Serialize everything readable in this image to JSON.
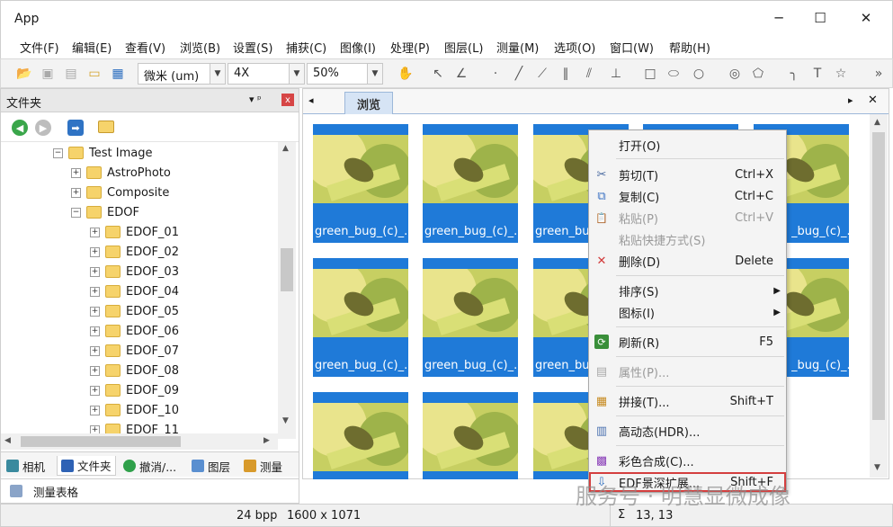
{
  "window": {
    "title": "App",
    "min_glyph": "─",
    "max_glyph": "☐",
    "close_glyph": "✕"
  },
  "menu": [
    "文件(F)",
    "编辑(E)",
    "查看(V)",
    "浏览(B)",
    "设置(S)",
    "捕获(C)",
    "图像(I)",
    "处理(P)",
    "图层(L)",
    "测量(M)",
    "选项(O)",
    "窗口(W)",
    "帮助(H)"
  ],
  "toolbar": {
    "unit": "微米 (um)",
    "magnification": "4X",
    "zoom": "50%",
    "overflow": "»"
  },
  "left_panel": {
    "title": "文件夹",
    "pin": "▾ ᵖ",
    "close": "x",
    "tree": [
      {
        "label": "Test Image",
        "expander": "−"
      },
      {
        "label": "AstroPhoto",
        "expander": "+"
      },
      {
        "label": "Composite",
        "expander": "+"
      },
      {
        "label": "EDOF",
        "expander": "−"
      },
      {
        "label": "EDOF_01",
        "expander": "+"
      },
      {
        "label": "EDOF_02",
        "expander": "+"
      },
      {
        "label": "EDOF_03",
        "expander": "+"
      },
      {
        "label": "EDOF_04",
        "expander": "+"
      },
      {
        "label": "EDOF_05",
        "expander": "+"
      },
      {
        "label": "EDOF_06",
        "expander": "+"
      },
      {
        "label": "EDOF_07",
        "expander": "+"
      },
      {
        "label": "EDOF_08",
        "expander": "+"
      },
      {
        "label": "EDOF_09",
        "expander": "+"
      },
      {
        "label": "EDOF_10",
        "expander": "+"
      },
      {
        "label": "EDOF_11",
        "expander": "+"
      }
    ],
    "tabs": [
      "相机",
      "文件夹",
      "撤消/...",
      "图层",
      "测量"
    ],
    "measure_table": "测量表格"
  },
  "browser": {
    "tab_label": "浏览",
    "nav_left": "◂",
    "nav_right": "▸",
    "close": "✕",
    "thumb_label": "green_bug_(c)_...",
    "thumb_label_short": "green_bu",
    "thumb_label_tail": "_bug_(c)_..."
  },
  "context_menu": {
    "items": [
      {
        "label": "打开(O)",
        "shortcut": "",
        "icon": "",
        "disabled": false
      },
      {
        "label": "剪切(T)",
        "shortcut": "Ctrl+X",
        "icon": "✂",
        "disabled": false
      },
      {
        "label": "复制(C)",
        "shortcut": "Ctrl+C",
        "icon": "⧉",
        "disabled": false
      },
      {
        "label": "粘贴(P)",
        "shortcut": "Ctrl+V",
        "icon": "📋",
        "disabled": true
      },
      {
        "label": "粘贴快捷方式(S)",
        "shortcut": "",
        "icon": "",
        "disabled": true
      },
      {
        "label": "删除(D)",
        "shortcut": "Delete",
        "icon": "✕",
        "disabled": false
      },
      {
        "label": "排序(S)",
        "shortcut": "▶",
        "icon": "",
        "disabled": false
      },
      {
        "label": "图标(I)",
        "shortcut": "▶",
        "icon": "",
        "disabled": false
      },
      {
        "label": "刷新(R)",
        "shortcut": "F5",
        "icon": "⟳",
        "disabled": false
      },
      {
        "label": "属性(P)...",
        "shortcut": "",
        "icon": "▤",
        "disabled": true
      },
      {
        "label": "拼接(T)...",
        "shortcut": "Shift+T",
        "icon": "▦",
        "disabled": false
      },
      {
        "label": "高动态(HDR)...",
        "shortcut": "",
        "icon": "▥",
        "disabled": false
      },
      {
        "label": "彩色合成(C)...",
        "shortcut": "",
        "icon": "▩",
        "disabled": false
      },
      {
        "label": "EDF景深扩展...",
        "shortcut": "Shift+F",
        "icon": "⇩",
        "disabled": false
      }
    ]
  },
  "status": {
    "bpp": "24 bpp",
    "dims": "1600 x 1071",
    "sigma": "Σ",
    "coords": "13, 13"
  },
  "watermark": "服务号 · 明慧显微成像",
  "colors": {
    "thumb_bg": "#1f7ad8",
    "highlight_box": "#d43f3f",
    "tab_active": "#d6e4f5"
  }
}
